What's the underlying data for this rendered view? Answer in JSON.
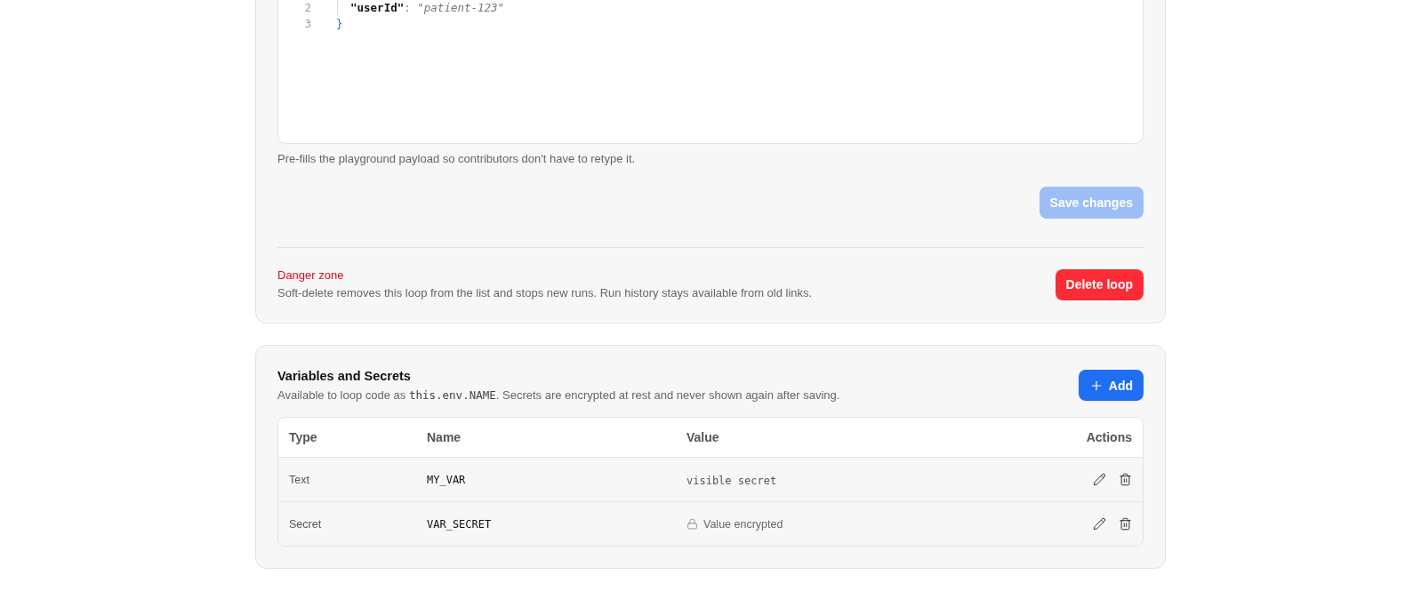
{
  "editor": {
    "lines": [
      {
        "number": "2",
        "indented": true,
        "tokens": [
          {
            "kind": "key",
            "text": "\"userId\""
          },
          {
            "kind": "punct",
            "text": ": "
          },
          {
            "kind": "string",
            "text": "\"patient-123\""
          }
        ]
      },
      {
        "number": "3",
        "indented": false,
        "tokens": [
          {
            "kind": "brace",
            "text": "}"
          }
        ]
      }
    ]
  },
  "payload_hint": "Pre-fills the playground payload so contributors don't have to retype it.",
  "save_button": {
    "label": "Save changes",
    "disabled": true
  },
  "danger_zone": {
    "title": "Danger zone",
    "description": "Soft-delete removes this loop from the list and stops new runs. Run history stays available from old links.",
    "button": "Delete loop"
  },
  "variables": {
    "title": "Variables and Secrets",
    "description": [
      {
        "kind": "plain",
        "text": "Available to loop code as "
      },
      {
        "kind": "code",
        "text": "this.env.NAME"
      },
      {
        "kind": "plain",
        "text": ". Secrets are encrypted at rest and never shown again after saving."
      }
    ],
    "add_button": "Add"
  },
  "table": {
    "columns": [
      "Type",
      "Name",
      "Value",
      "Actions"
    ],
    "rows": [
      {
        "kind": "text",
        "type": "Text",
        "name": "MY_VAR",
        "value": "visible secret"
      },
      {
        "kind": "secret",
        "type": "Secret",
        "name": "VAR_SECRET",
        "value": "Value encrypted"
      }
    ]
  }
}
